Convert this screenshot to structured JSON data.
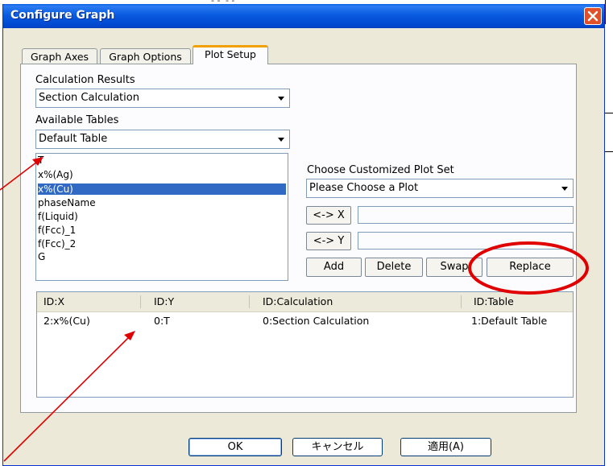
{
  "window": {
    "title": "Configure Graph",
    "close_icon": "close-icon"
  },
  "tabs": [
    {
      "label": "Graph Axes"
    },
    {
      "label": "Graph Options"
    },
    {
      "label": "Plot Setup"
    }
  ],
  "plot_setup": {
    "calculation_results_label": "Calculation Results",
    "calculation_results_value": "Section Calculation",
    "available_tables_label": "Available Tables",
    "available_tables_value": "Default Table",
    "variables": [
      "T",
      "x%(Ag)",
      "x%(Cu)",
      "phaseName",
      "f(Liquid)",
      "f(Fcc)_1",
      "f(Fcc)_2",
      "G"
    ],
    "selected_variable": "x%(Cu)",
    "custom_plot_set_label": "Choose Customized Plot Set",
    "custom_plot_set_value": "Please Choose a Plot",
    "set_x_label": "<-> X",
    "set_y_label": "<-> Y",
    "x_value": "",
    "y_value": "",
    "add_label": "Add",
    "delete_label": "Delete",
    "swap_label": "Swap",
    "replace_label": "Replace"
  },
  "grid": {
    "columns": [
      "ID:X",
      "ID:Y",
      "ID:Calculation",
      "ID:Table"
    ],
    "rows": [
      [
        "2:x%(Cu)",
        "0:T",
        "0:Section Calculation",
        "1:Default Table"
      ]
    ]
  },
  "footer": {
    "ok_label": "OK",
    "cancel_label": "キャンセル",
    "apply_label": "適用(A)"
  },
  "annotations": {
    "highlight_color": "#e00000",
    "arrow_color": "#e00000"
  }
}
